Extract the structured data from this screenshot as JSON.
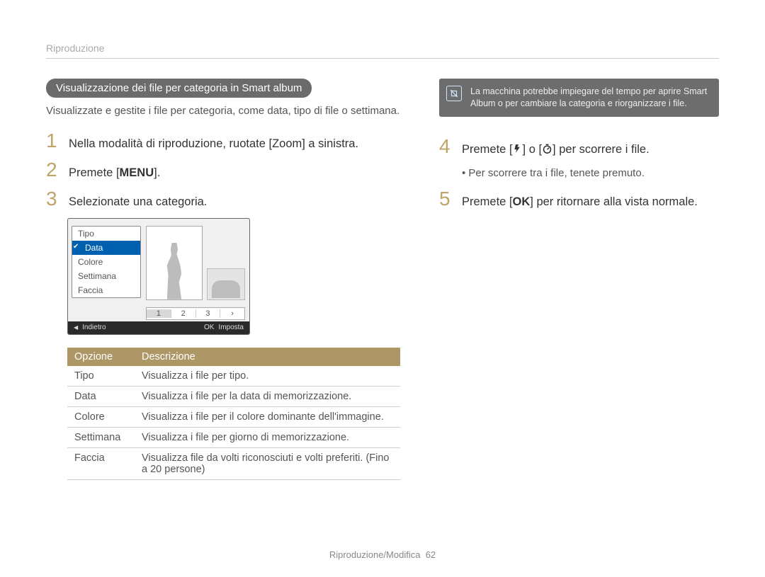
{
  "header": {
    "section": "Riproduzione"
  },
  "pill": "Visualizzazione dei ﬁle per categoria in Smart album",
  "intro": "Visualizzate e gestite i file per categoria, come data, tipo di file o settimana.",
  "steps_left": [
    {
      "n": "1",
      "text": "Nella modalità di riproduzione, ruotate [Zoom] a sinistra."
    },
    {
      "n": "2",
      "prefix": "Premete [",
      "glyph": "MENU",
      "suffix": "]."
    },
    {
      "n": "3",
      "text": "Selezionate una categoria."
    }
  ],
  "camera_menu": {
    "items": [
      "Tipo",
      "Data",
      "Colore",
      "Settimana",
      "Faccia"
    ],
    "selected_index": 1,
    "pages": [
      "1",
      "2",
      "3",
      "›"
    ],
    "footer_back": "Indietro",
    "footer_ok": "OK",
    "footer_set": "Imposta",
    "back_arrow": "◀"
  },
  "table": {
    "head": [
      "Opzione",
      "Descrizione"
    ],
    "rows": [
      [
        "Tipo",
        "Visualizza i file per tipo."
      ],
      [
        "Data",
        "Visualizza i file per la data di memorizzazione."
      ],
      [
        "Colore",
        "Visualizza i file per il colore dominante dell'immagine."
      ],
      [
        "Settimana",
        "Visualizza i file per giorno di memorizzazione."
      ],
      [
        "Faccia",
        "Visualizza file da volti riconosciuti e volti preferiti. (Fino a 20 persone)"
      ]
    ]
  },
  "note": {
    "text": "La macchina potrebbe impiegare del tempo per aprire Smart Album o per cambiare la categoria e riorganizzare i file."
  },
  "steps_right": [
    {
      "n": "4",
      "parts": [
        "Premete [",
        "__flash__",
        "] o [",
        "__timer__",
        "] per scorrere i ﬁle."
      ]
    },
    {
      "n": "5",
      "parts": [
        "Premete [",
        "__ok__",
        "] per ritornare alla vista normale."
      ]
    }
  ],
  "bullet_right": "Per scorrere tra i file, tenete premuto.",
  "footer": {
    "label": "Riproduzione/Modifica",
    "page": "62"
  }
}
